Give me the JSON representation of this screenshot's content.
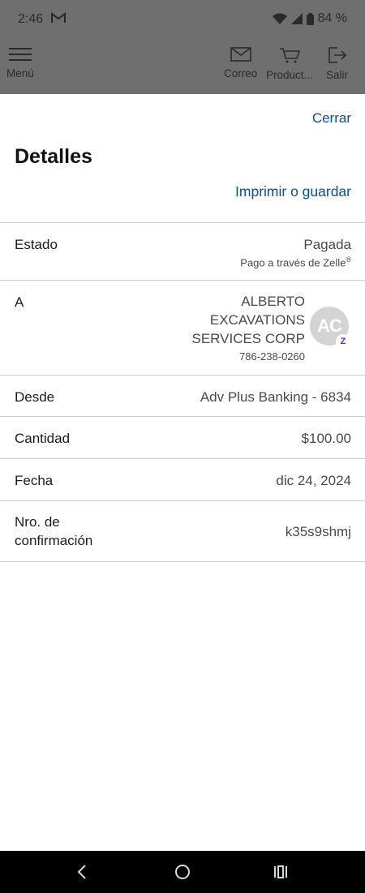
{
  "status_bar": {
    "time": "2:46",
    "battery": "84 %",
    "icons": [
      "gmail-icon",
      "wifi-icon",
      "signal-icon",
      "battery-icon"
    ]
  },
  "toolbar": {
    "menu_label": "Menú",
    "mail_label": "Correo",
    "products_label": "Product...",
    "exit_label": "Salir"
  },
  "sheet": {
    "close_label": "Cerrar",
    "title": "Detalles",
    "print_label": "Imprimir o guardar"
  },
  "details": {
    "status": {
      "label": "Estado",
      "value": "Pagada",
      "sub": "Pago a través de Zelle",
      "sub_mark": "®"
    },
    "to": {
      "label": "A",
      "name_lines": [
        "ALBERTO",
        "EXCAVATIONS",
        "SERVICES CORP"
      ],
      "phone": "786-238-0260",
      "avatar_initials": "AC",
      "badge": "Z"
    },
    "from": {
      "label": "Desde",
      "value": "Adv Plus Banking - 6834"
    },
    "amount": {
      "label": "Cantidad",
      "value": "$100.00"
    },
    "date": {
      "label": "Fecha",
      "value": "dic 24, 2024"
    },
    "confirmation": {
      "label_line1": "Nro. de",
      "label_line2": "confirmación",
      "value": "k35s9shmj"
    }
  },
  "colors": {
    "link": "#0b4fa0",
    "overlay": "#6f6f6f",
    "zelle": "#6d1ed4"
  }
}
